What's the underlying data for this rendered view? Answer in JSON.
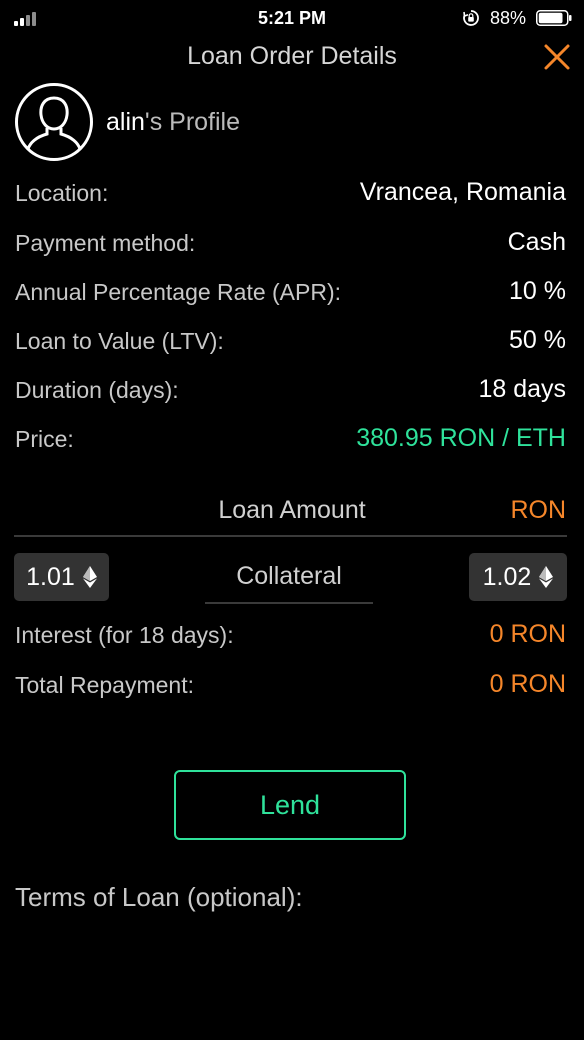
{
  "status_bar": {
    "time": "5:21 PM",
    "battery_percent": "88%",
    "battery_level": 0.88,
    "icons": [
      "signal-icon",
      "rotation-lock-icon",
      "battery-icon"
    ]
  },
  "header": {
    "title": "Loan Order Details",
    "close_icon": "close-icon",
    "accent_color": "#f5862a"
  },
  "profile": {
    "username": "alin",
    "suffix": "'s Profile",
    "avatar_icon": "user-avatar-icon"
  },
  "details": {
    "location": {
      "label": "Location:",
      "value": "Vrancea, Romania"
    },
    "payment_method": {
      "label": "Payment method:",
      "value": "Cash"
    },
    "apr": {
      "label": "Annual Percentage Rate (APR):",
      "value": "10 %"
    },
    "ltv": {
      "label": "Loan to Value (LTV):",
      "value": "50 %"
    },
    "duration": {
      "label": "Duration (days):",
      "value": "18 days"
    },
    "price": {
      "label": "Price:",
      "value": "380.95 RON / ETH",
      "color": "#2fe29b"
    }
  },
  "loan": {
    "amount_label": "Loan Amount",
    "currency": "RON",
    "collateral_label": "Collateral",
    "collateral_min": "1.01",
    "collateral_max": "1.02",
    "eth_icon": "ethereum-icon"
  },
  "summary": {
    "interest": {
      "label": "Interest (for 18 days):",
      "value": "0 RON"
    },
    "total": {
      "label": "Total Repayment:",
      "value": "0 RON"
    }
  },
  "actions": {
    "lend_label": "Lend",
    "lend_color": "#2fe29b"
  },
  "terms": {
    "label": "Terms of Loan (optional):"
  }
}
